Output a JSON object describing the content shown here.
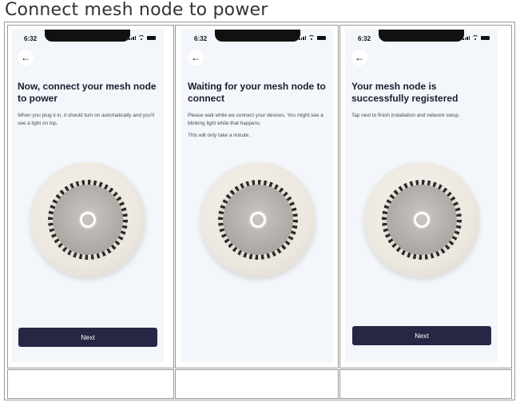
{
  "doc_title": "Connect mesh node to power",
  "screens": [
    {
      "time": "6:32",
      "heading": "Now, connect your mesh node to power",
      "paragraphs": [
        "When you plug it in, it should turn on automatically and you'll see a light on top."
      ],
      "button_label": "Next"
    },
    {
      "time": "6:32",
      "heading": "Waiting for your mesh node to connect",
      "paragraphs": [
        "Please wait while we connect your devices. You might see a blinking light while that happens.",
        "This will only take a minute."
      ],
      "button_label": ""
    },
    {
      "time": "6:32",
      "heading": "Your mesh node is successfully registered",
      "paragraphs": [
        "Tap next to finish installation and network setup."
      ],
      "button_label": "Next"
    }
  ],
  "icons": {
    "back": "back-arrow-icon",
    "signal": "signal-icon",
    "wifi": "wifi-icon",
    "battery": "battery-icon"
  },
  "colors": {
    "button_bg": "#262744",
    "screen_bg": "#f3f6fb",
    "heading_text": "#1c1c2e"
  }
}
